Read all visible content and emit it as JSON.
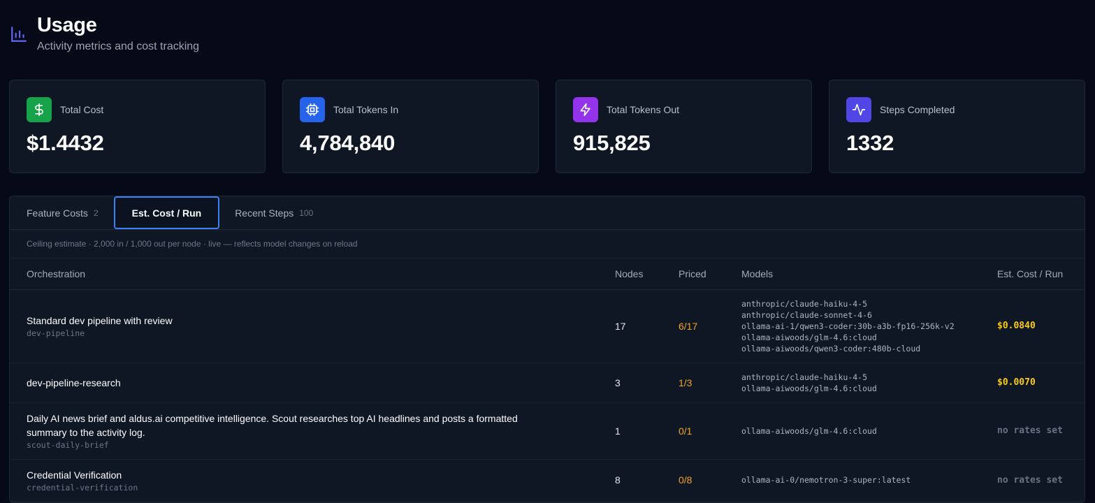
{
  "header": {
    "title": "Usage",
    "subtitle": "Activity metrics and cost tracking",
    "icon": "bar-chart-icon"
  },
  "cards": [
    {
      "label": "Total Cost",
      "value": "$1.4432",
      "icon": "dollar-icon",
      "color": "#16a34a"
    },
    {
      "label": "Total Tokens In",
      "value": "4,784,840",
      "icon": "cpu-icon",
      "color": "#2563eb"
    },
    {
      "label": "Total Tokens Out",
      "value": "915,825",
      "icon": "lightning-icon",
      "color": "#9333ea"
    },
    {
      "label": "Steps Completed",
      "value": "1332",
      "icon": "activity-icon",
      "color": "#4f46e5"
    }
  ],
  "tabs": [
    {
      "label": "Feature Costs",
      "count": "2"
    },
    {
      "label": "Est. Cost / Run",
      "count": ""
    },
    {
      "label": "Recent Steps",
      "count": "100"
    }
  ],
  "note": "Ceiling estimate · 2,000 in / 1,000 out per node · live — reflects model changes on reload",
  "table": {
    "headers": [
      "Orchestration",
      "Nodes",
      "Priced",
      "Models",
      "Est. Cost / Run"
    ],
    "rows": [
      {
        "title": "Standard dev pipeline with review",
        "slug": "dev-pipeline",
        "nodes": "17",
        "priced": "6/17",
        "models": [
          "anthropic/claude-haiku-4-5",
          "anthropic/claude-sonnet-4-6",
          "ollama-ai-1/qwen3-coder:30b-a3b-fp16-256k-v2",
          "ollama-aiwoods/glm-4.6:cloud",
          "ollama-aiwoods/qwen3-coder:480b-cloud"
        ],
        "cost": "$0.0840"
      },
      {
        "title": "dev-pipeline-research",
        "slug": "",
        "nodes": "3",
        "priced": "1/3",
        "models": [
          "anthropic/claude-haiku-4-5",
          "ollama-aiwoods/glm-4.6:cloud"
        ],
        "cost": "$0.0070"
      },
      {
        "title": "Daily AI news brief and aldus.ai competitive intelligence. Scout researches top AI headlines and posts a formatted summary to the activity log.",
        "slug": "scout-daily-brief",
        "nodes": "1",
        "priced": "0/1",
        "models": [
          "ollama-aiwoods/glm-4.6:cloud"
        ],
        "cost": "no rates set"
      },
      {
        "title": "Credential Verification",
        "slug": "credential-verification",
        "nodes": "8",
        "priced": "0/8",
        "models": [
          "ollama-ai-0/nemotron-3-super:latest"
        ],
        "cost": "no rates set"
      }
    ]
  }
}
